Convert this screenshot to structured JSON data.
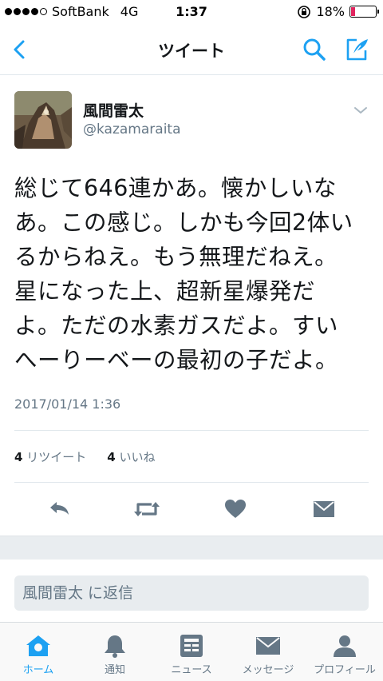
{
  "status_bar": {
    "carrier": "SoftBank",
    "network": "4G",
    "time": "1:37",
    "battery_pct_label": "18%",
    "battery_level": 0.18
  },
  "nav": {
    "title": "ツイート"
  },
  "tweet": {
    "display_name": "風間雷太",
    "handle": "@kazamaraita",
    "text": "総じて646連かあ。懐かしいな\nあ。この感じ。しかも今回2体い\nるからねえ。もう無理だねえ。\n星になった上、超新星爆発だ\nよ。ただの水素ガスだよ。すい\nへーりーベーの最初の子だよ。",
    "timestamp": "2017/01/14 1:36",
    "retweet_count": "4",
    "retweet_label": "リツイート",
    "like_count": "4",
    "like_label": "いいね"
  },
  "reply": {
    "placeholder": "風間雷太 に返信"
  },
  "tabs": [
    {
      "label": "ホーム",
      "icon": "home-icon",
      "active": true
    },
    {
      "label": "通知",
      "icon": "bell-icon",
      "active": false
    },
    {
      "label": "ニュース",
      "icon": "news-icon",
      "active": false
    },
    {
      "label": "メッセージ",
      "icon": "mail-icon",
      "active": false
    },
    {
      "label": "プロフィール",
      "icon": "profile-icon",
      "active": false
    }
  ],
  "colors": {
    "accent": "#1da1f2",
    "action_icon": "#657786",
    "battery": "#e0245e"
  }
}
